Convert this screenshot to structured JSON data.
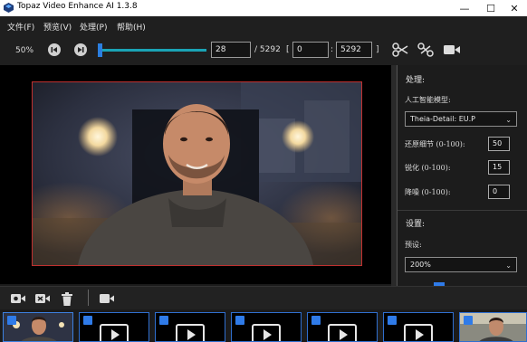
{
  "window": {
    "title": "Topaz Video Enhance AI 1.3.8",
    "minimize_glyph": "—",
    "maximize_glyph": "☐",
    "close_glyph": "✕"
  },
  "menu": {
    "items": [
      {
        "label": "文件(F)"
      },
      {
        "label": "预览(V)"
      },
      {
        "label": "处理(P)"
      },
      {
        "label": "帮助(H)"
      }
    ]
  },
  "toolbar": {
    "zoom": "50%",
    "current_frame": "28",
    "total_frames_text": "/ 5292",
    "bracket_open": "[",
    "range_start": "0",
    "range_separator": ":",
    "range_end": "5292",
    "bracket_close": "]",
    "playback_progress": 0.005
  },
  "panel": {
    "processing_title": "处理:",
    "ai_model_label": "人工智能模型:",
    "ai_model_value": "Theia-Detail: EU.P",
    "restore_label": "还原细节 (0-100):",
    "restore_value": "50",
    "sharpen_label": "锐化 (0-100):",
    "sharpen_value": "15",
    "denoise_label": "降噪 (0-100):",
    "denoise_value": "0",
    "settings_title": "设置:",
    "preset_label": "预设:",
    "preset_value": "200%"
  },
  "icons": {
    "prev": "skip-back-icon",
    "next": "skip-forward-icon",
    "cut": "scissors-icon",
    "split": "split-scissors-icon",
    "camera": "video-camera-icon"
  },
  "colors": {
    "accent": "#2f7be8",
    "slider": "#1aa3b5",
    "preview_border": "#c0302f"
  }
}
